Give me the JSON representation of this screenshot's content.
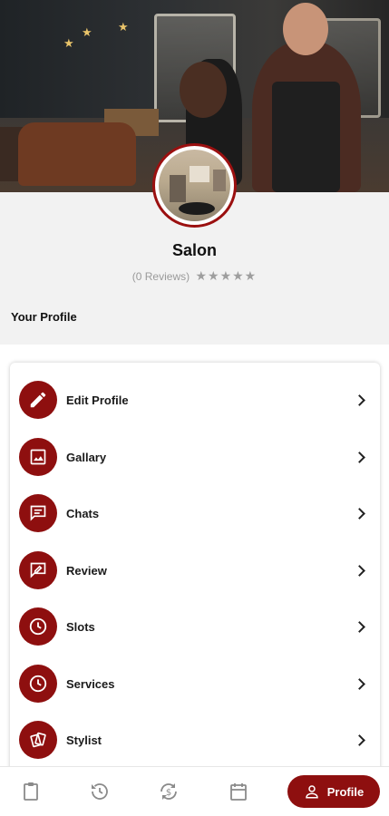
{
  "profile": {
    "name": "Salon",
    "reviews_text": "(0 Reviews)",
    "stars": "★★★★★",
    "rating_value": 0
  },
  "section": {
    "title": "Your Profile"
  },
  "menu": [
    {
      "label": "Edit Profile",
      "icon": "pencil-icon"
    },
    {
      "label": "Gallary",
      "icon": "image-icon"
    },
    {
      "label": "Chats",
      "icon": "chat-icon"
    },
    {
      "label": "Review",
      "icon": "review-icon"
    },
    {
      "label": "Slots",
      "icon": "clock-icon"
    },
    {
      "label": "Services",
      "icon": "clock-icon"
    },
    {
      "label": "Stylist",
      "icon": "stylist-cards-icon"
    }
  ],
  "bottom_nav": {
    "items": [
      "clipboard-icon",
      "history-icon",
      "sync-money-icon",
      "calendar-icon"
    ],
    "active_label": "Profile",
    "active_icon": "person-icon"
  },
  "colors": {
    "accent": "#8e0f0f",
    "background": "#f2f2f2"
  }
}
